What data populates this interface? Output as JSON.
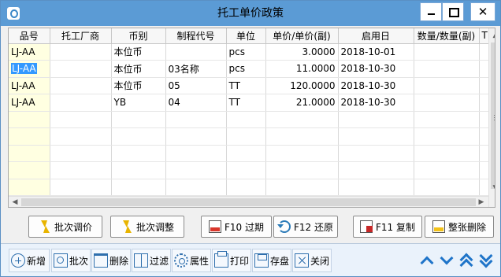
{
  "window": {
    "title": "托工单价政策"
  },
  "grid": {
    "columns": [
      "品号",
      "托工厂商",
      "币别",
      "制程代号",
      "单位",
      "单价/单价(副)",
      "启用日",
      "数量/数量(副)",
      "T"
    ],
    "rows": [
      [
        "LJ-AA",
        "",
        "本位币",
        "",
        "pcs",
        "3.0000",
        "2018-10-01",
        "",
        ""
      ],
      [
        "LJ-AA",
        "",
        "本位币",
        "03名称",
        "pcs",
        "11.0000",
        "2018-10-30",
        "",
        ""
      ],
      [
        "LJ-AA",
        "",
        "本位币",
        "05",
        "TT",
        "120.0000",
        "2018-10-30",
        "",
        ""
      ],
      [
        "LJ-AA",
        "",
        "YB",
        "04",
        "TT",
        "21.0000",
        "2018-10-30",
        "",
        ""
      ],
      [
        "",
        "",
        "",
        "",
        "",
        "",
        "",
        "",
        ""
      ],
      [
        "",
        "",
        "",
        "",
        "",
        "",
        "",
        "",
        ""
      ],
      [
        "",
        "",
        "",
        "",
        "",
        "",
        "",
        "",
        ""
      ],
      [
        "",
        "",
        "",
        "",
        "",
        "",
        "",
        "",
        ""
      ],
      [
        "",
        "",
        "",
        "",
        "",
        "",
        "",
        "",
        ""
      ]
    ]
  },
  "actions": {
    "batch_price": "批次调价",
    "batch_adjust": "批次调整",
    "f10_expire": "F10 过期",
    "f12_restore": "F12 还原",
    "f11_copy": "F11 复制",
    "delete_all": "整张删除"
  },
  "toolbar": {
    "add": "新增",
    "batch": "批次",
    "delete": "删除",
    "filter": "过滤",
    "properties": "属性",
    "print": "打印",
    "save": "存盘",
    "close": "关闭"
  },
  "colors": {
    "titlebar": "#5b9bd5",
    "first_col": "#ffffe1",
    "nav_arrows": "#1f74c9"
  }
}
